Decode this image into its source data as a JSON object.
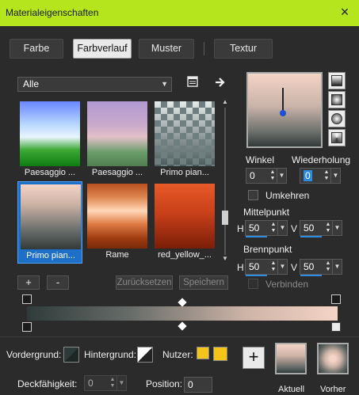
{
  "window": {
    "title": "Materialeigenschaften",
    "close_icon": "×"
  },
  "tabs": [
    {
      "label": "Farbe"
    },
    {
      "label": "Farbverlauf",
      "active": true
    },
    {
      "label": "Muster"
    },
    {
      "label": "Textur"
    }
  ],
  "category": {
    "selected": "Alle"
  },
  "gallery": {
    "items": [
      {
        "label": "Paesaggio ..."
      },
      {
        "label": "Paesaggio ..."
      },
      {
        "label": "Primo pian..."
      },
      {
        "label": "Primo pian...",
        "selected": true
      },
      {
        "label": "Rame"
      },
      {
        "label": "red_yellow_..."
      }
    ]
  },
  "gallery_buttons": {
    "add": "+",
    "remove": "-",
    "reset": "Zurücksetzen",
    "save": "Speichern"
  },
  "angle": {
    "label": "Winkel",
    "value": "0"
  },
  "repeat": {
    "label": "Wiederholung",
    "value": "0"
  },
  "invert": {
    "label": "Umkehren",
    "checked": false
  },
  "midpoint": {
    "label": "Mittelpunkt",
    "h_label": "H",
    "h_value": "50",
    "v_label": "V",
    "v_value": "50"
  },
  "focus": {
    "label": "Brennpunkt",
    "h_label": "H",
    "h_value": "50",
    "v_label": "V",
    "v_value": "50"
  },
  "link": {
    "label": "Verbinden",
    "checked": false
  },
  "bottom": {
    "foreground_label": "Vordergrund:",
    "background_label": "Hintergrund:",
    "user_label": "Nutzer:",
    "opacity_label": "Deckfähigkeit:",
    "opacity_value": "0",
    "position_label": "Position:",
    "position_value": "0",
    "current_label": "Aktuell",
    "previous_label": "Vorher"
  },
  "colors": {
    "title_bar": "#b5e61d",
    "accent": "#2f8de0",
    "user_swatch": "#f5c418",
    "gradient_start": "#2f3b3a",
    "gradient_end": "#f4d4c6"
  }
}
